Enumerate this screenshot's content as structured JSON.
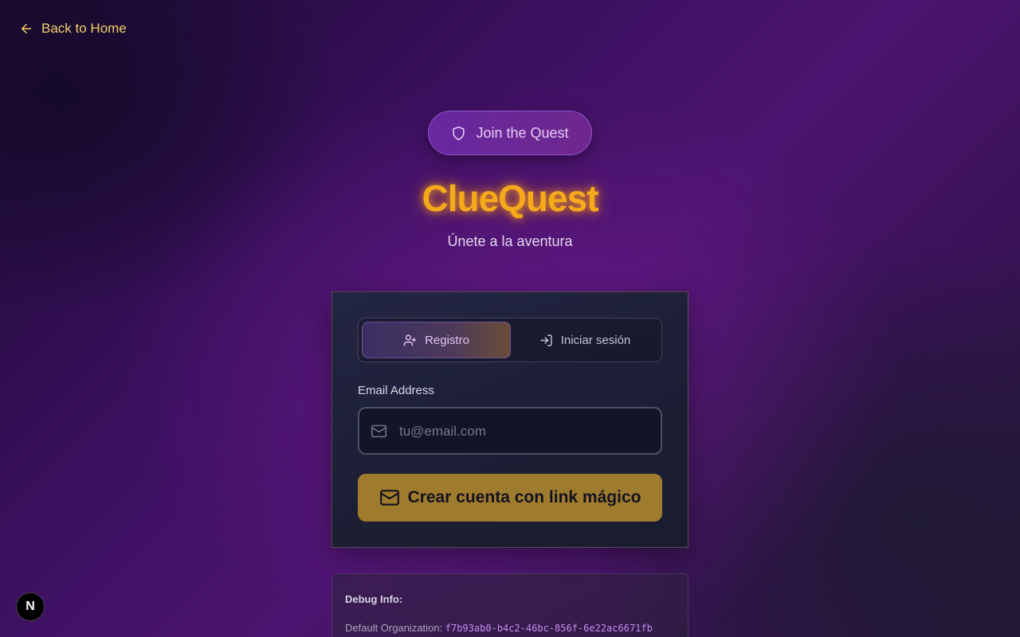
{
  "nav": {
    "back_label": "Back to Home",
    "back_icon": "arrow-left-icon"
  },
  "hero": {
    "badge_label": "Join the Quest",
    "badge_icon": "shield-icon",
    "title": "ClueQuest",
    "subtitle": "Únete a la aventura"
  },
  "auth": {
    "tabs": [
      {
        "label": "Registro",
        "icon": "user-plus-icon",
        "active": true
      },
      {
        "label": "Iniciar sesión",
        "icon": "log-in-icon",
        "active": false
      }
    ],
    "email": {
      "label": "Email Address",
      "placeholder": "tu@email.com",
      "value": "",
      "icon": "mail-icon"
    },
    "submit_label": "Crear cuenta con link mágico",
    "submit_icon": "mail-icon"
  },
  "debug": {
    "title": "Debug Info:",
    "org_label": "Default Organization:",
    "org_value": "f7b93ab0-b4c2-46bc-856f-6e22ac6671fb"
  },
  "dev_badge": {
    "label": "N"
  },
  "colors": {
    "accent_gold": "#f6a91a",
    "button_gold": "#9f7b2d",
    "link_yellow": "#f3cf6d",
    "purple_badge": "#6e2daa",
    "debug_value": "#c48cf0"
  }
}
